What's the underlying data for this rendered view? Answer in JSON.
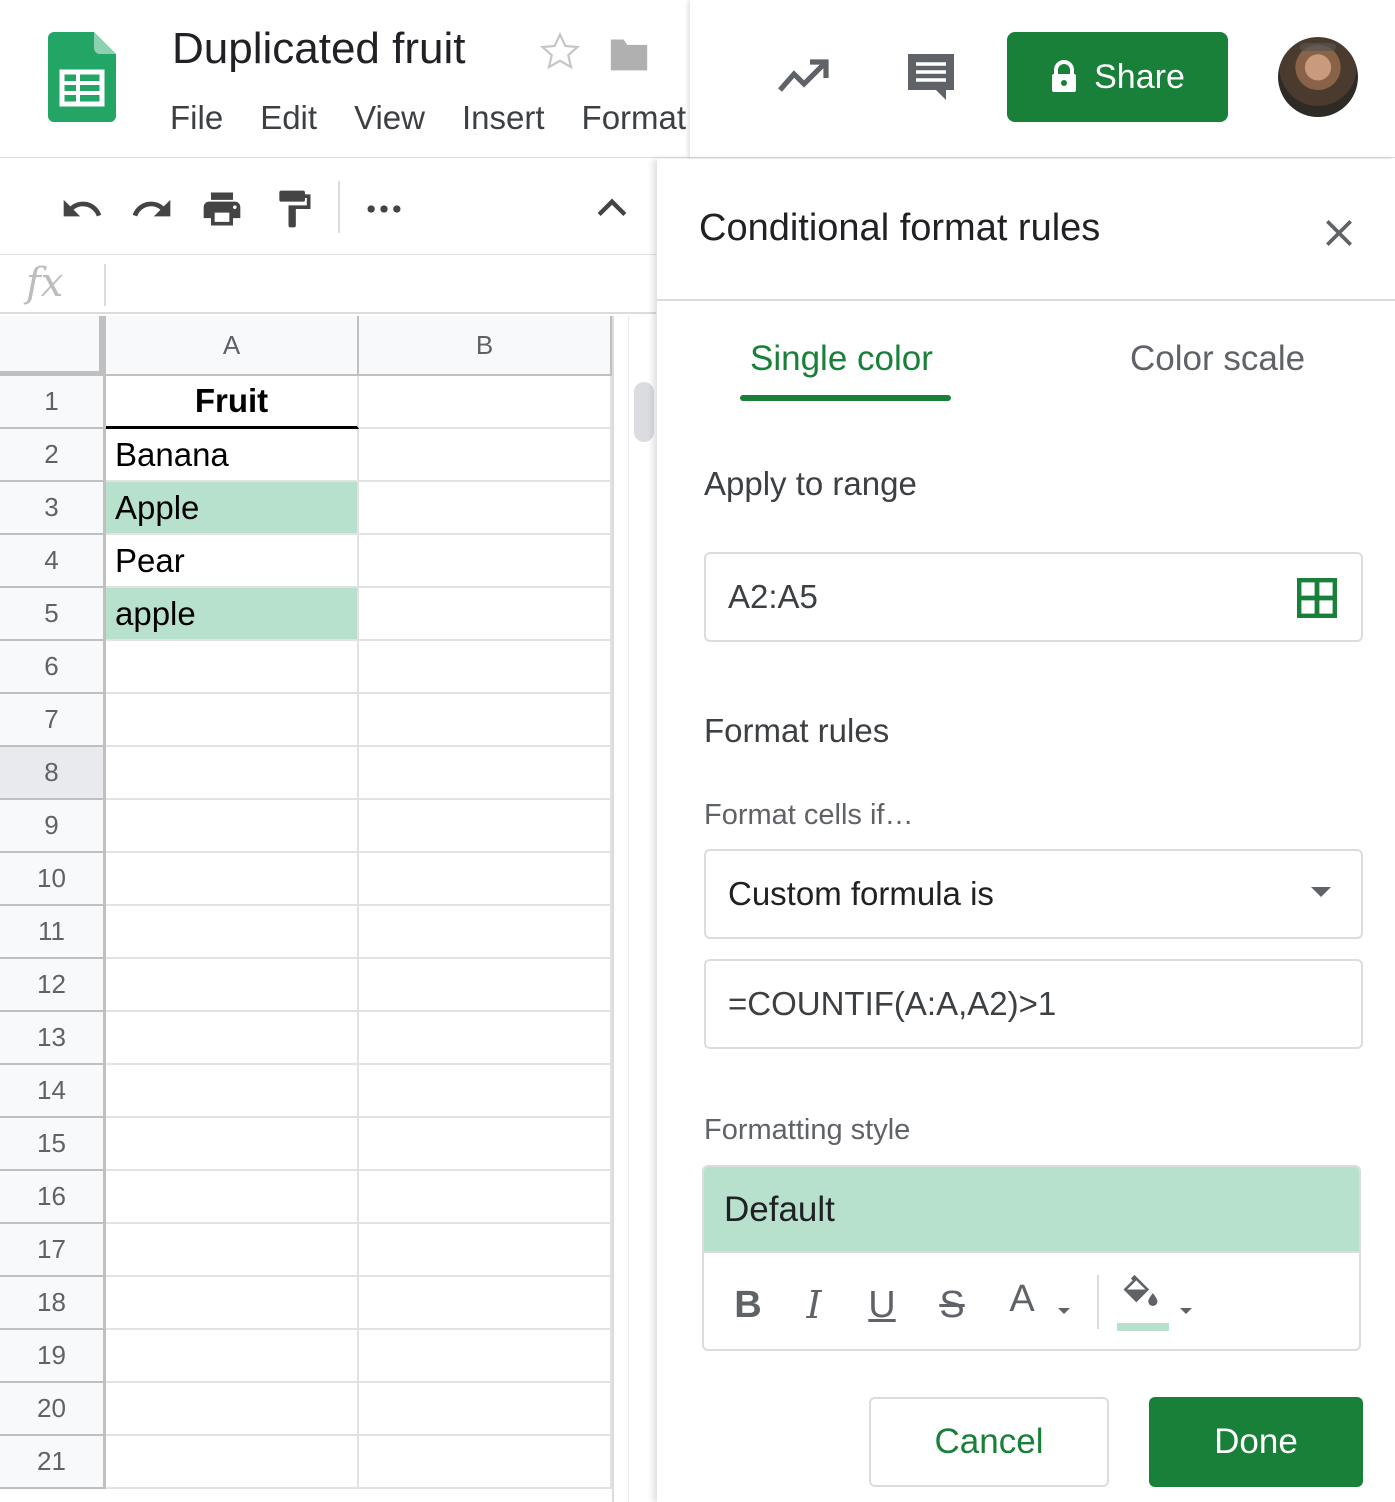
{
  "doc": {
    "title": "Duplicated fruit"
  },
  "menu": [
    "File",
    "Edit",
    "View",
    "Insert",
    "Format"
  ],
  "share": {
    "label": "Share"
  },
  "grid": {
    "columns": [
      "A",
      "B"
    ],
    "rows": [
      "1",
      "2",
      "3",
      "4",
      "5",
      "6",
      "7",
      "8",
      "9",
      "10",
      "11",
      "12",
      "13",
      "14",
      "15",
      "16",
      "17",
      "18",
      "19",
      "20",
      "21"
    ],
    "cells": {
      "A1": "Fruit",
      "A2": "Banana",
      "A3": "Apple",
      "A4": "Pear",
      "A5": "apple"
    },
    "highlight_color": "#b7e1cd"
  },
  "panel": {
    "title": "Conditional format rules",
    "tabs": {
      "single": "Single color",
      "scale": "Color scale"
    },
    "apply_label": "Apply to range",
    "range": "A2:A5",
    "rules_label": "Format rules",
    "cells_if_label": "Format cells if…",
    "condition": "Custom formula is",
    "formula": "=COUNTIF(A:A,A2)>1",
    "style_label": "Formatting style",
    "style_preview": "Default",
    "fmt": {
      "bold": "B",
      "italic": "I",
      "underline": "U",
      "strike": "S",
      "textcolor": "A"
    },
    "cancel": "Cancel",
    "done": "Done"
  },
  "colors": {
    "accent": "#188038",
    "highlight": "#b7e1cd"
  }
}
